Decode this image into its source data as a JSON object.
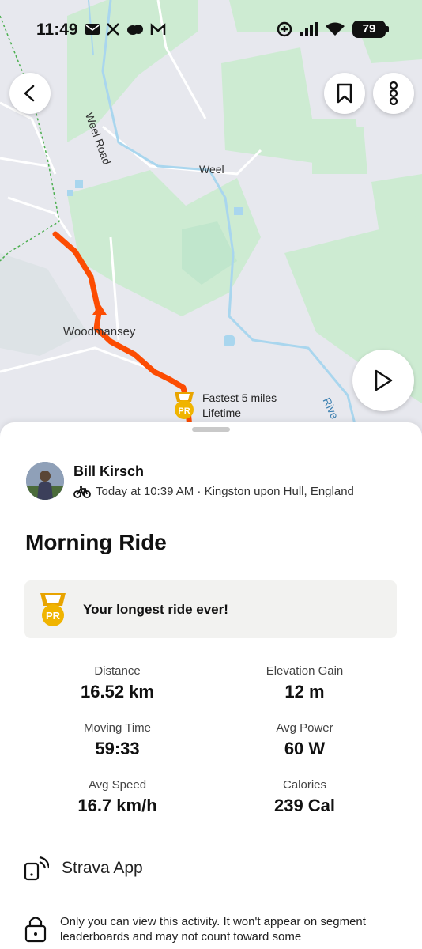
{
  "status_bar": {
    "time": "11:49",
    "battery": "79",
    "left_icons": [
      "mail-icon",
      "x-icon",
      "cloud-icon",
      "gmail-icon"
    ],
    "right_icons": [
      "data-saver-icon",
      "signal-icon",
      "wifi-icon",
      "battery-icon"
    ]
  },
  "map": {
    "labels": {
      "weel_road": "Weel Road",
      "weel": "Weel",
      "woodmansey": "Woodmansey",
      "river": "Rive"
    },
    "pr_badge": "PR",
    "pr_line1": "Fastest 5 miles",
    "pr_line2": "Lifetime",
    "colors": {
      "route": "#fc4c02",
      "water": "#a9d6ee",
      "green": "#cdebd2",
      "land": "#e7e8ee"
    }
  },
  "activity": {
    "athlete_name": "Bill Kirsch",
    "meta": "Today at 10:39 AM · Kingston upon Hull, England",
    "title": "Morning Ride",
    "achievement_badge": "PR",
    "achievement": "Your longest ride ever!",
    "stats": [
      {
        "label": "Distance",
        "value": "16.52 km"
      },
      {
        "label": "Elevation Gain",
        "value": "12 m"
      },
      {
        "label": "Moving Time",
        "value": "59:33"
      },
      {
        "label": "Avg Power",
        "value": "60 W"
      },
      {
        "label": "Avg Speed",
        "value": "16.7 km/h"
      },
      {
        "label": "Calories",
        "value": "239 Cal"
      }
    ],
    "device": "Strava App",
    "privacy": "Only you can view this activity. It won't appear on segment leaderboards and may not count toward some"
  }
}
